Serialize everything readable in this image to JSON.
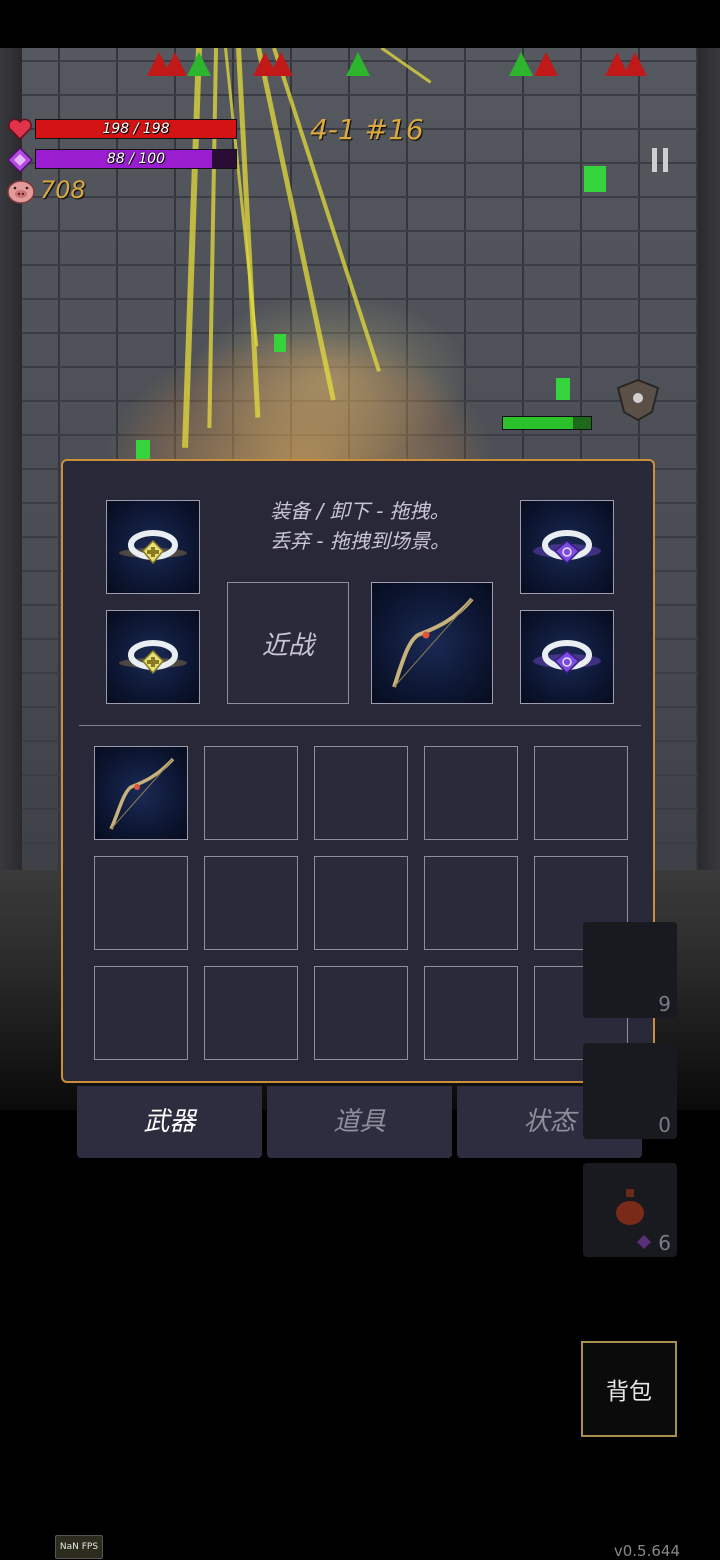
{
  "hud": {
    "hp": {
      "current": 198,
      "max": 198,
      "label": "198 / 198",
      "fill": 1.0,
      "color": "#d41414"
    },
    "mp": {
      "current": 88,
      "max": 100,
      "label": "88 / 100",
      "fill": 0.88,
      "color": "#9a1ed0"
    },
    "gold": "708",
    "stage": "4-1 #16",
    "pause_icon": "pause-icon"
  },
  "inventory": {
    "help_line1": "装备 / 卸下 - 拖拽。",
    "help_line2": "丢弃 - 拖拽到场景。",
    "melee_slot_label": "近战",
    "equipped": {
      "ring_left_top": "gold-gem-ring",
      "ring_left_bottom": "gold-gem-ring",
      "weapon": "bow",
      "ring_right_top": "purple-gem-ring",
      "ring_right_bottom": "purple-gem-ring"
    },
    "grid": [
      "bow",
      "",
      "",
      "",
      "",
      "",
      "",
      "",
      "",
      "",
      "",
      "",
      "",
      "",
      ""
    ]
  },
  "tabs": [
    {
      "label": "武器",
      "active": true
    },
    {
      "label": "道具",
      "active": false
    },
    {
      "label": "状态",
      "active": false
    }
  ],
  "quick_slots": [
    {
      "count": "9"
    },
    {
      "count": "0"
    },
    {
      "count": "6",
      "icon": "potion-icon"
    }
  ],
  "backpack_button": "背包",
  "fps": "NaN FPS",
  "version": "v0.5.644",
  "colors": {
    "panel_border": "#c98f3c",
    "panel_bg": "#292838",
    "accent_gold": "#d9a93f"
  }
}
